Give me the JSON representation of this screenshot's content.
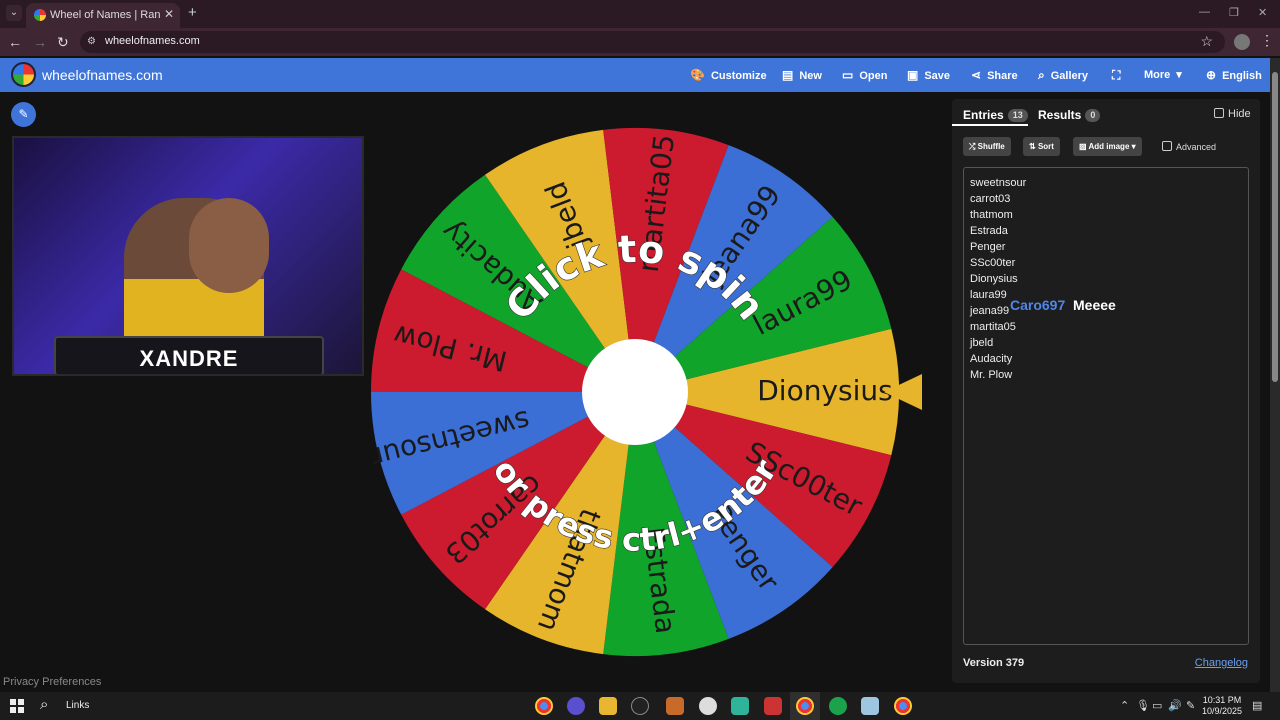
{
  "browser": {
    "tab_title": "Wheel of Names | Random name",
    "url": "wheelofnames.com"
  },
  "app": {
    "logo_text": "wheelofnames.com",
    "nav": {
      "customize": "Customize",
      "new": "New",
      "open": "Open",
      "save": "Save",
      "share": "Share",
      "gallery": "Gallery",
      "more": "More",
      "language": "English"
    }
  },
  "webcam": {
    "overlay_name": "XANDRE"
  },
  "wheel": {
    "prompt_top": "Click to spin",
    "prompt_bottom": "or press ctrl+enter",
    "segments": [
      {
        "label": "Dionysius",
        "color": "#e6b52c"
      },
      {
        "label": "SSc00ter",
        "color": "#cc1b2e"
      },
      {
        "label": "Penger",
        "color": "#3b6fd6"
      },
      {
        "label": "Estrada",
        "color": "#11a42b"
      },
      {
        "label": "thatmom",
        "color": "#e6b52c"
      },
      {
        "label": "carrot03",
        "color": "#cc1b2e"
      },
      {
        "label": "sweetnsour",
        "color": "#3b6fd6"
      },
      {
        "label": "Mr. Plow",
        "color": "#cc1b2e"
      },
      {
        "label": "Audacity",
        "color": "#11a42b"
      },
      {
        "label": "jbeld",
        "color": "#e6b52c"
      },
      {
        "label": "martita05",
        "color": "#cc1b2e"
      },
      {
        "label": "jeana99",
        "color": "#3b6fd6"
      },
      {
        "label": "laura99",
        "color": "#11a42b"
      }
    ]
  },
  "privacy_link": "Privacy Preferences",
  "panel": {
    "tab_entries": "Entries",
    "entries_count": "13",
    "tab_results": "Results",
    "results_count": "0",
    "hide_label": "Hide",
    "shuffle": "Shuffle",
    "sort": "Sort",
    "add_image": "Add image",
    "advanced": "Advanced",
    "entries": [
      "sweetnsour",
      "carrot03",
      "thatmom",
      "Estrada",
      "Penger",
      "SSc00ter",
      "Dionysius",
      "laura99",
      "jeana99",
      "martita05",
      "jbeld",
      "Audacity",
      "Mr. Plow"
    ],
    "overlay_names": [
      {
        "text": "Caro697",
        "color": "#4f86e8"
      },
      {
        "text": "Meeee",
        "color": "#ffffff"
      }
    ],
    "version": "Version 379",
    "changelog": "Changelog"
  },
  "taskbar": {
    "links": "Links",
    "time": "10:31 PM",
    "date": "10/9/2025"
  }
}
